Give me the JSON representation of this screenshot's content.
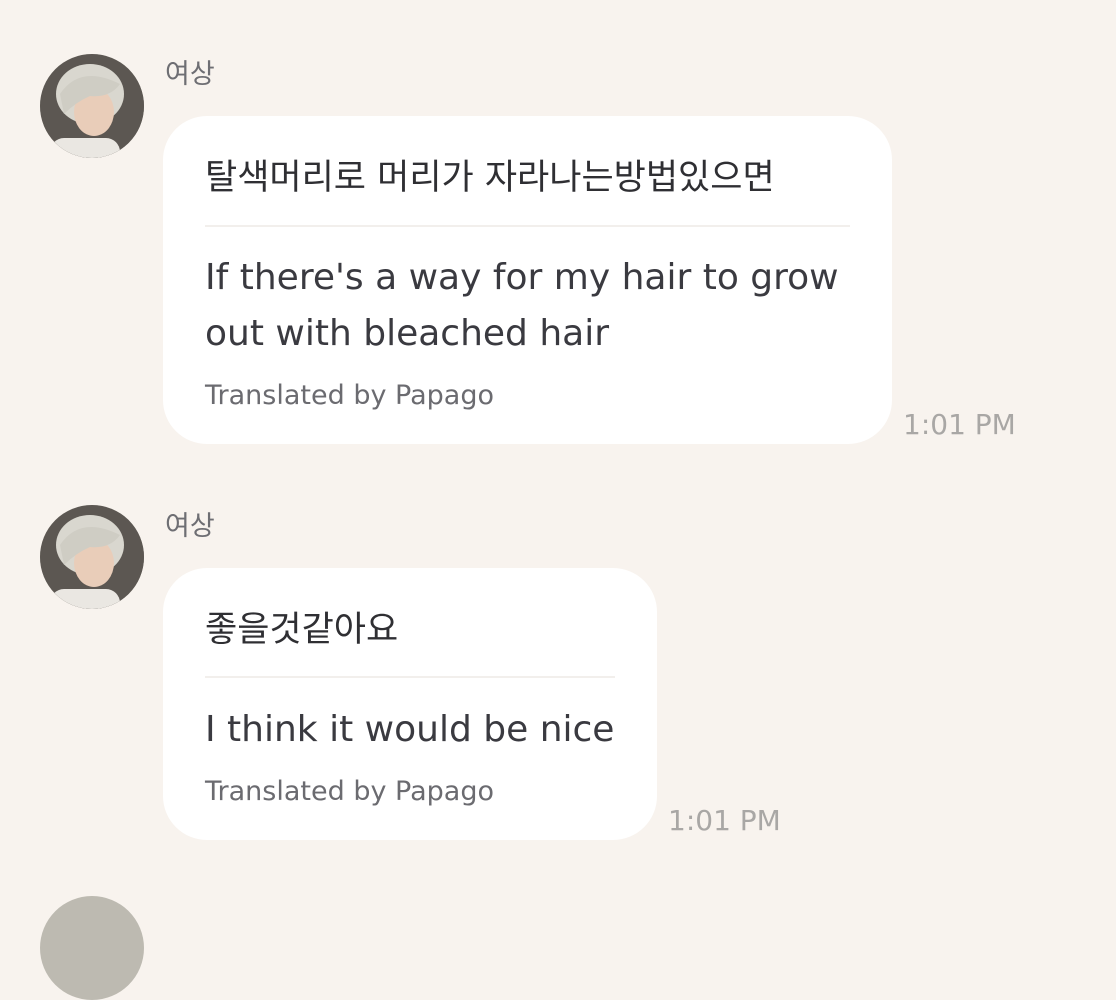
{
  "messages": [
    {
      "sender": "여상",
      "original": "탈색머리로 머리가 자라나는방법있으면",
      "translation": "If there's a way for my hair to grow out with bleached hair",
      "translation_credit": "Translated by Papago",
      "time": "1:01 PM"
    },
    {
      "sender": "여상",
      "original": "좋을것같아요",
      "translation": "I think it would be nice",
      "translation_credit": "Translated by Papago",
      "time": "1:01 PM"
    }
  ],
  "icons": {
    "avatar": "profile-photo"
  },
  "colors": {
    "background": "#f8f3ee",
    "bubble": "#ffffff",
    "timestamp": "#a9a7a5"
  }
}
